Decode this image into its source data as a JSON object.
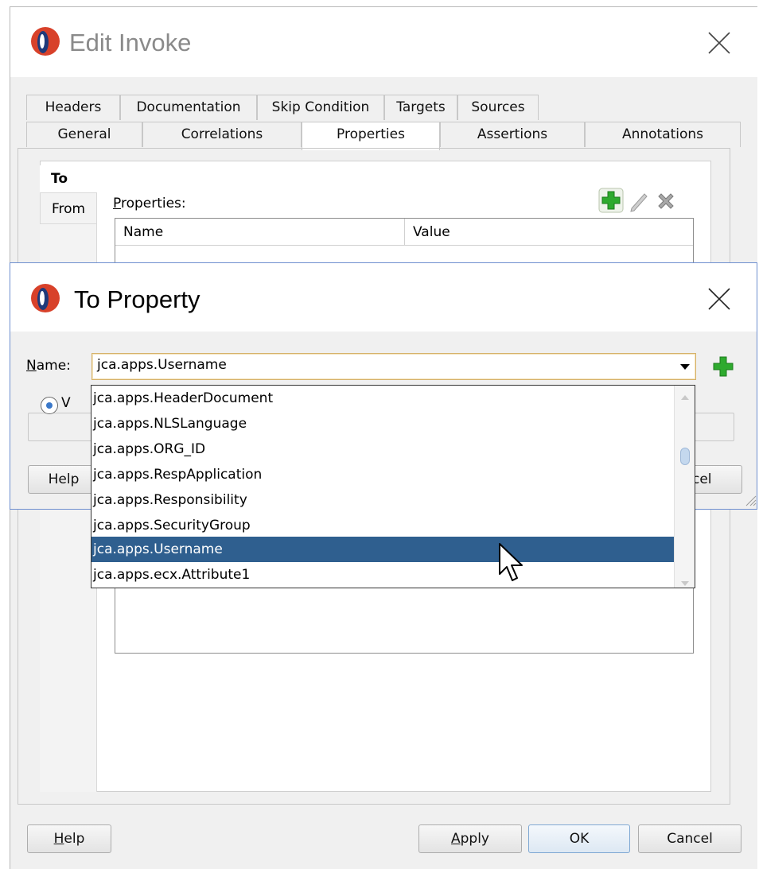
{
  "edit_dialog": {
    "title": "Edit Invoke",
    "tabs_row1": [
      "Headers",
      "Documentation",
      "Skip Condition",
      "Targets",
      "Sources"
    ],
    "tabs_row2": [
      "General",
      "Correlations",
      "Properties",
      "Assertions",
      "Annotations"
    ],
    "selected_tab": "Properties",
    "side_tabs": {
      "to": "To",
      "from": "From"
    },
    "properties_label": "Properties:",
    "table_columns": [
      "Name",
      "Value"
    ],
    "buttons": {
      "help": "Help",
      "apply": "Apply",
      "ok": "OK",
      "cancel": "Cancel"
    }
  },
  "to_property_dialog": {
    "title": "To Property",
    "name_label": "Name:",
    "name_value": "jca.apps.Username",
    "partial_radio_text": "V",
    "partial_help": "Help",
    "partial_cancel": "cel"
  },
  "dropdown": {
    "items": [
      "jca.apps.HeaderDocument",
      "jca.apps.NLSLanguage",
      "jca.apps.ORG_ID",
      "jca.apps.RespApplication",
      "jca.apps.Responsibility",
      "jca.apps.SecurityGroup",
      "jca.apps.Username",
      "jca.apps.ecx.Attribute1"
    ],
    "selected_index": 6
  },
  "colors": {
    "selection": "#2f5f8f",
    "app_icon_red": "#d8412a",
    "app_icon_blue": "#1f3a7a",
    "add_green": "#2eaa2e"
  }
}
